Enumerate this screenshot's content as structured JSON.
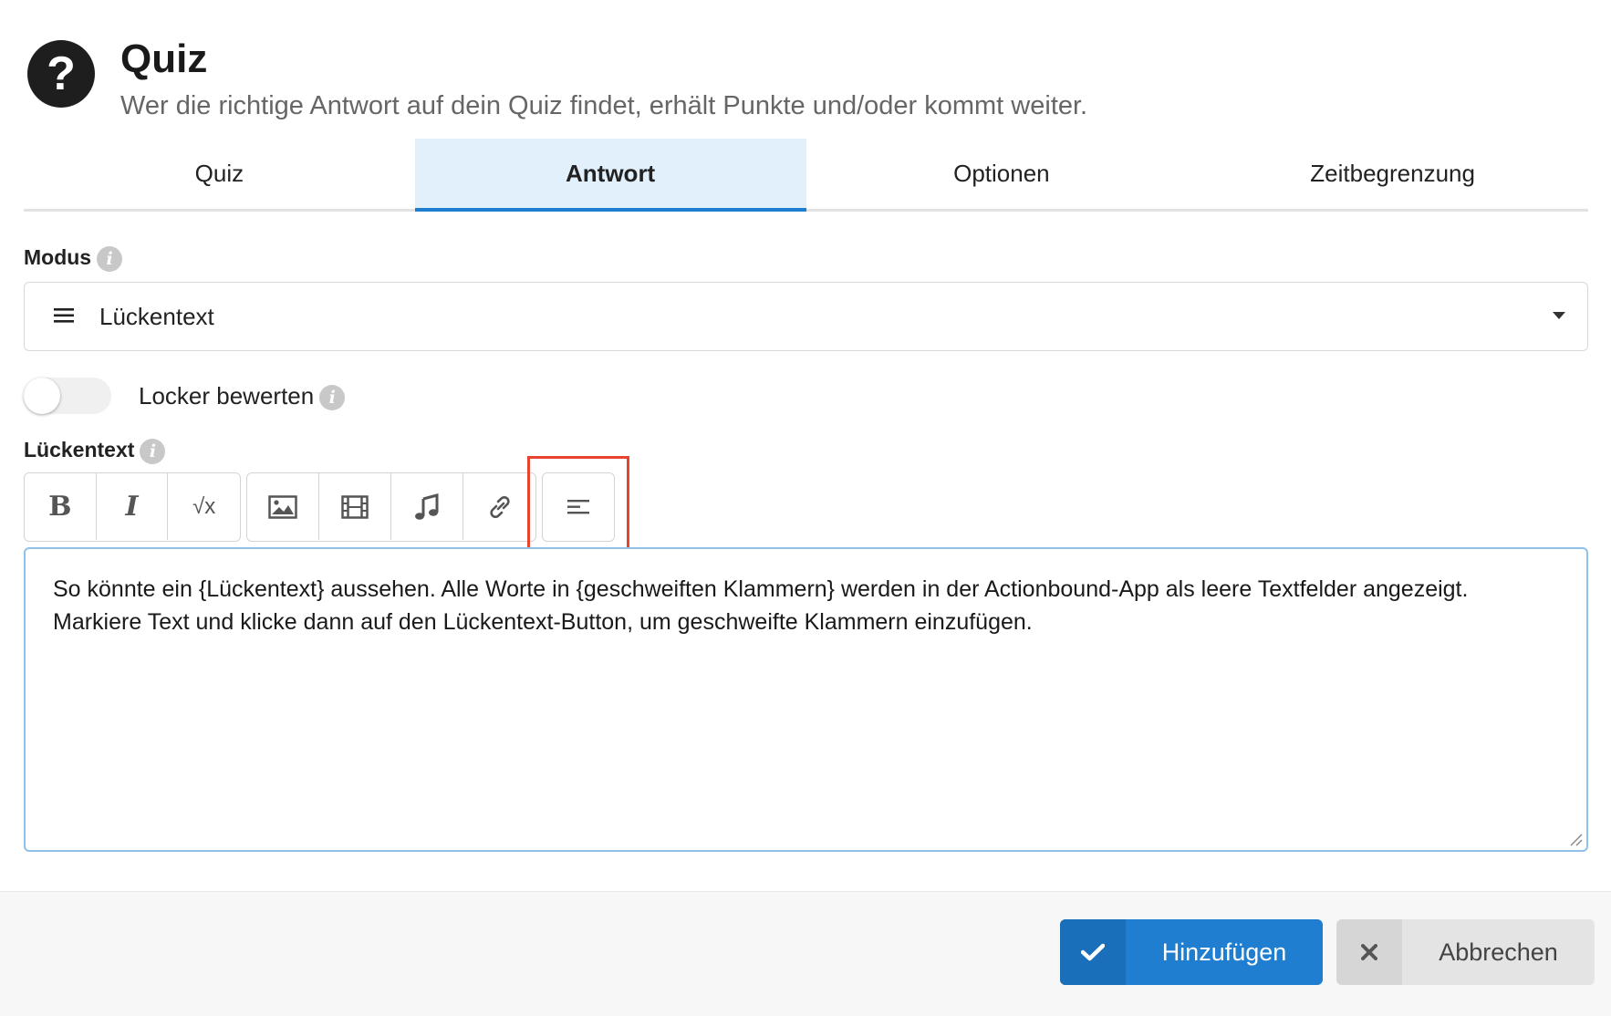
{
  "header": {
    "icon": "question-circle-icon",
    "title": "Quiz",
    "subtitle": "Wer die richtige Antwort auf dein Quiz findet, erhält Punkte und/oder kommt weiter."
  },
  "tabs": [
    {
      "label": "Quiz",
      "active": false
    },
    {
      "label": "Antwort",
      "active": true
    },
    {
      "label": "Optionen",
      "active": false
    },
    {
      "label": "Zeitbegrenzung",
      "active": false
    }
  ],
  "modus": {
    "label": "Modus",
    "icon": "lines-icon",
    "value": "Lückentext"
  },
  "toggle": {
    "label": "Locker bewerten",
    "on": false
  },
  "editor": {
    "label": "Lückentext",
    "toolbar": [
      {
        "name": "bold-button",
        "icon": "bold-icon",
        "glyph": "B"
      },
      {
        "name": "italic-button",
        "icon": "italic-icon",
        "glyph": "I"
      },
      {
        "name": "formula-button",
        "icon": "sqrt-icon",
        "glyph": "√x"
      },
      {
        "name": "image-button",
        "icon": "image-icon"
      },
      {
        "name": "video-button",
        "icon": "film-icon"
      },
      {
        "name": "audio-button",
        "icon": "music-note-icon"
      },
      {
        "name": "link-button",
        "icon": "link-icon"
      },
      {
        "name": "gap-text-button",
        "icon": "gap-text-icon"
      }
    ],
    "text": "So könnte ein {Lückentext} aussehen. Alle Worte in {geschweiften Klammern} werden in der Actionbound-App als leere Textfelder angezeigt. Markiere Text und klicke dann auf den Lückentext-Button, um geschweifte Klammern einzufügen."
  },
  "footer": {
    "primary": {
      "icon": "check-icon",
      "label": "Hinzufügen"
    },
    "secondary": {
      "icon": "close-icon",
      "label": "Abbrechen"
    }
  },
  "colors": {
    "accent": "#1f7ed0",
    "active_tab_bg": "#e2f0fb",
    "highlight": "#e8432f"
  }
}
